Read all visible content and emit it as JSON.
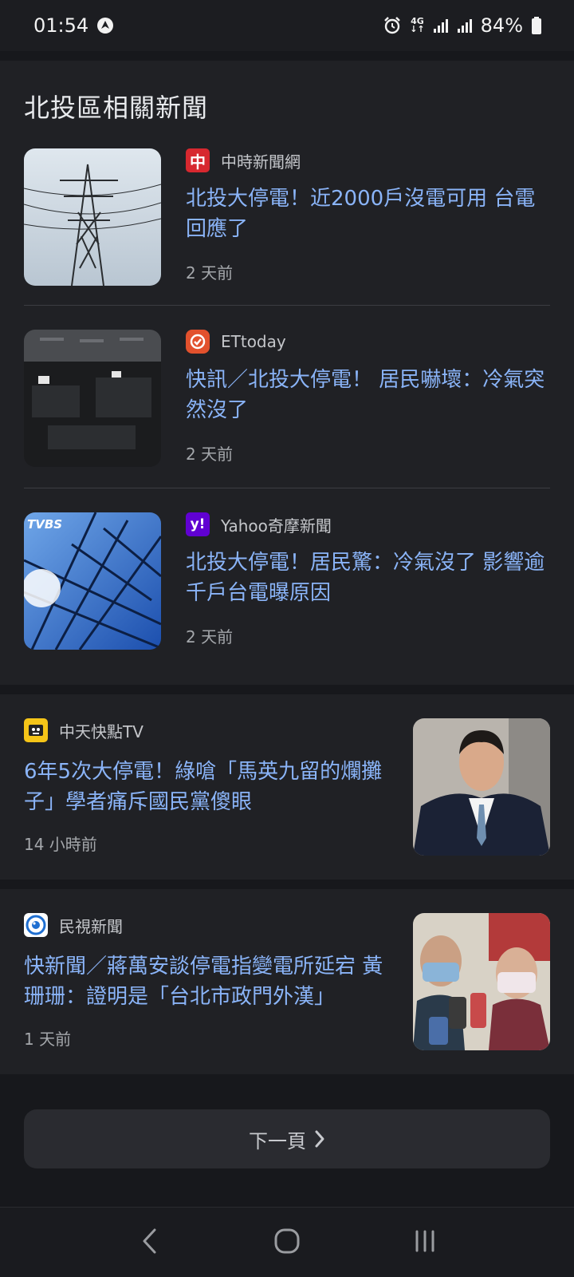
{
  "status_bar": {
    "time": "01:54",
    "network": "4G",
    "battery": "84%",
    "icons": [
      "alarm-icon",
      "network-4g-icon",
      "signal-icon",
      "signal-icon",
      "battery-icon"
    ]
  },
  "related": {
    "title": "北投區相關新聞",
    "items": [
      {
        "source": "中時新聞網",
        "logo_text": "中",
        "logo_color": "#d7282f",
        "headline": "北投大停電！近2000戶沒電可用 台電回應了",
        "time": "2 天前"
      },
      {
        "source": "ETtoday",
        "logo_color": "#e2512d",
        "headline": "快訊／北投大停電！ 居民嚇壞：冷氣突然沒了",
        "time": "2 天前"
      },
      {
        "source": "Yahoo奇摩新聞",
        "logo_text": "y!",
        "logo_color": "#6001d2",
        "headline": "北投大停電！居民驚：冷氣沒了 影響逾千戶台電曝原因",
        "time": "2 天前",
        "thumb_text": "TVBS"
      }
    ]
  },
  "stories": [
    {
      "source": "中天快點TV",
      "logo_color": "#f5c518",
      "headline": "6年5次大停電！綠嗆「馬英九留的爛攤子」學者痛斥國民黨傻眼",
      "time": "14 小時前"
    },
    {
      "source": "民視新聞",
      "logo_color": "#1f6fd1",
      "headline": "快新聞／蔣萬安談停電指變電所延宕 黃珊珊：證明是「台北市政門外漢」",
      "time": "1 天前"
    }
  ],
  "pagination": {
    "next_label": "下一頁"
  },
  "colors": {
    "link": "#8ab4f8",
    "card": "#202125",
    "background": "#17181c"
  }
}
